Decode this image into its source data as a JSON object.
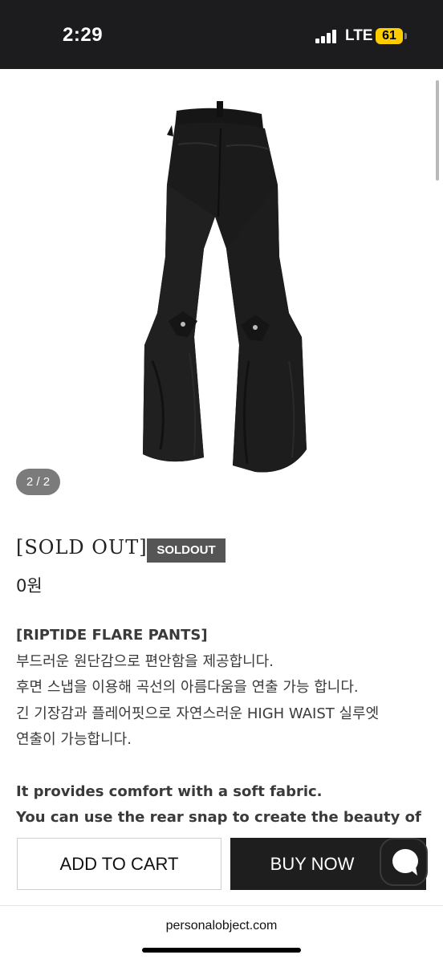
{
  "status_bar": {
    "time": "2:29",
    "network": "LTE",
    "battery": "61",
    "battery_color": "#ffcc00"
  },
  "gallery": {
    "counter": "2 / 2",
    "image": "black-flare-pants-back-view"
  },
  "product": {
    "title": "[SOLD OUT]",
    "badge": "SOLDOUT",
    "price": "0원",
    "description": {
      "name": "[RIPTIDE FLARE PANTS]",
      "lines": [
        "부드러운 원단감으로 편안함을 제공합니다.",
        "후면 스냅을 이용해 곡선의 아름다움을 연출 가능 합니다.",
        "긴 기장감과 플레어핏으로 자연스러운 HIGH WAIST 실루엣",
        "연출이 가능합니다."
      ],
      "english_lines": [
        "It provides comfort with a soft fabric.",
        "You can use the rear snap to create the beauty of"
      ]
    }
  },
  "actions": {
    "add_to_cart": "ADD TO CART",
    "buy_now": "BUY NOW",
    "chat_icon": "chat-bubble-icon"
  },
  "browser": {
    "url": "personalobject.com"
  }
}
